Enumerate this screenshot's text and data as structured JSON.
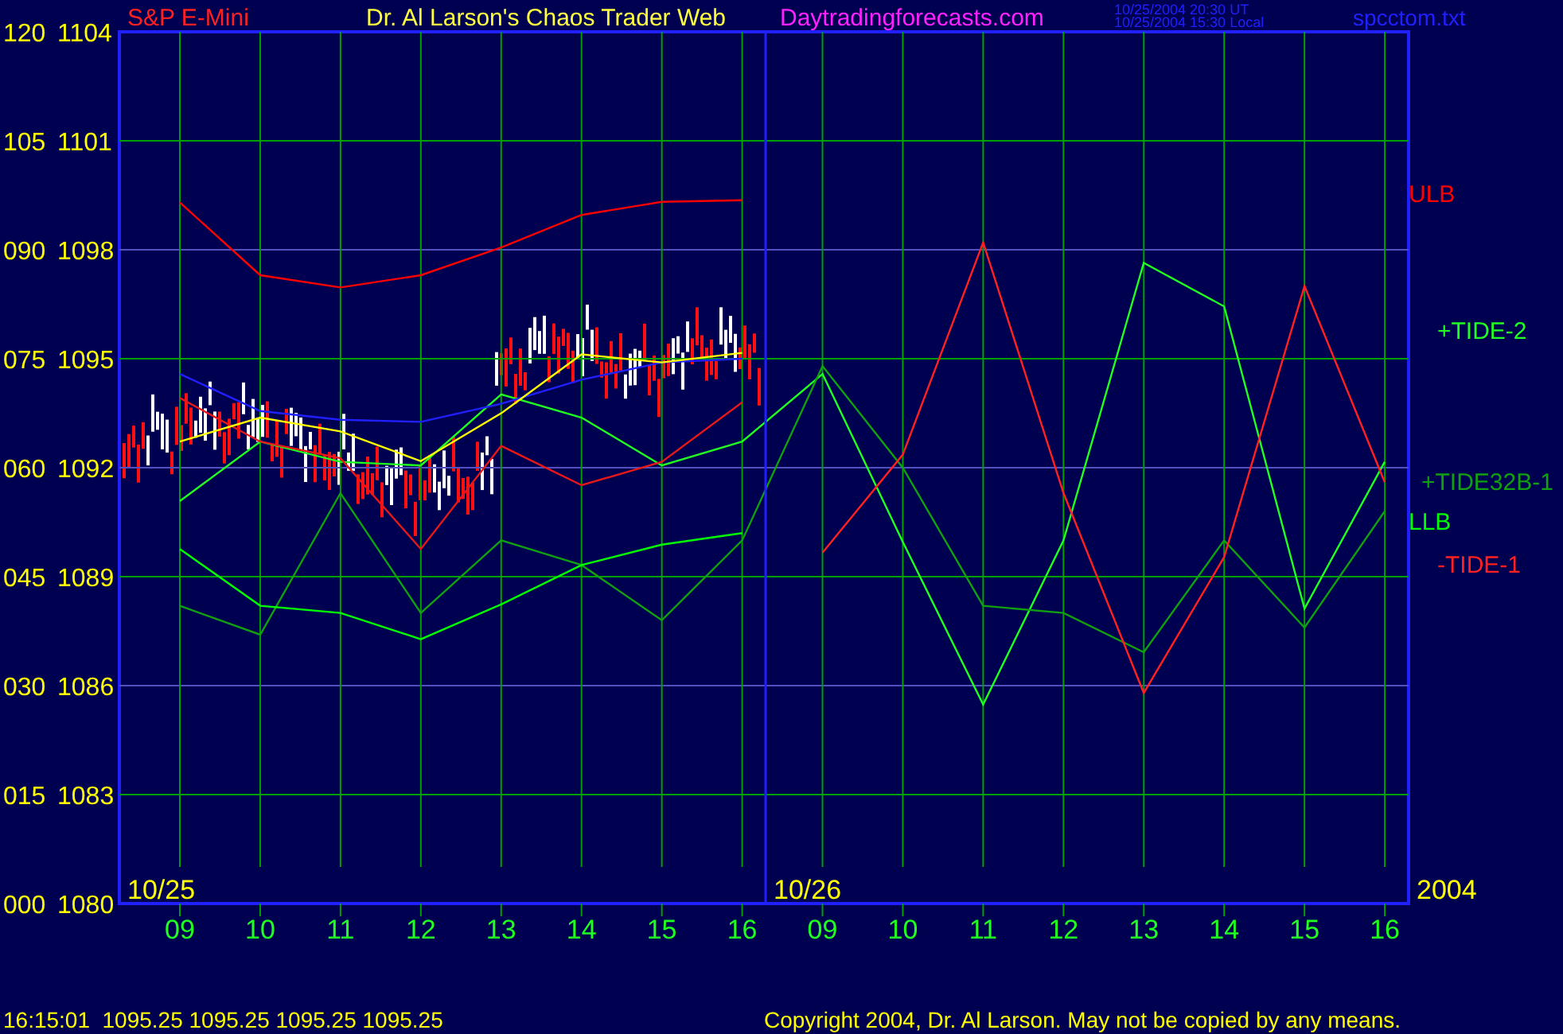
{
  "chart": {
    "instrument": "S&P E-Mini",
    "title": "Dr. Al Larson's Chaos Trader Web",
    "site": "Daytradingforecasts.com",
    "timestamps": [
      "10/25/2004 20:30 UT",
      "10/25/2004 15:30 Local"
    ],
    "file": "spcctom.txt",
    "price_labels": [
      "1104",
      "1101",
      "1098",
      "1095",
      "1092",
      "1089",
      "1086",
      "1083",
      "1080"
    ],
    "date_labels": [
      "10/25",
      "10/26",
      "2004"
    ],
    "chart_data": {
      "type": "line",
      "grid": true,
      "ylim": [
        0,
        120
      ],
      "categories": [
        "09",
        "10",
        "11",
        "12",
        "13",
        "14",
        "15",
        "16",
        "09",
        "10",
        "11",
        "12",
        "13",
        "14",
        "15",
        "16"
      ],
      "yticks": [
        {
          "value": 120,
          "label": "120"
        },
        {
          "value": 105,
          "label": "105"
        },
        {
          "value": 90,
          "label": "090"
        },
        {
          "value": 75,
          "label": "075"
        },
        {
          "value": 60,
          "label": "060"
        },
        {
          "value": 45,
          "label": "045"
        },
        {
          "value": 30,
          "label": "030"
        },
        {
          "value": 15,
          "label": "015"
        },
        {
          "value": 0,
          "label": "000"
        }
      ],
      "series": [
        {
          "name": "ULB",
          "color": "#ff0000",
          "values": [
            96.5,
            86.5,
            84.8,
            86.5,
            90.3,
            94.8,
            96.6,
            96.8,
            null,
            null,
            null,
            null,
            null,
            null,
            null,
            null
          ]
        },
        {
          "name": "+TIDE-2",
          "color": "#20ff20",
          "values": [
            55.4,
            63.6,
            60.8,
            60.3,
            70.1,
            66.9,
            60.3,
            63.6,
            72.9,
            49.8,
            27.4,
            50,
            88.2,
            82.2,
            40.6,
            60.8
          ]
        },
        {
          "name": "+TIDE32B-1",
          "color": "#10a010",
          "values": [
            41,
            37,
            56.5,
            40,
            50,
            46.6,
            39,
            50,
            74,
            60,
            41,
            40,
            34.6,
            50,
            38,
            54
          ]
        },
        {
          "name": "LLB",
          "color": "#00ff00",
          "values": [
            48.8,
            41,
            40,
            36.4,
            41.2,
            46.6,
            49.4,
            51,
            null,
            null,
            null,
            null,
            null,
            null,
            null,
            null
          ]
        },
        {
          "name": "-TIDE-1",
          "color": "#ff2020",
          "values": [
            null,
            null,
            null,
            null,
            null,
            null,
            null,
            null,
            48.3,
            61.8,
            91,
            56.5,
            29,
            47.7,
            85,
            58
          ]
        },
        {
          "color": "#2020ff",
          "values": [
            72.9,
            67.8,
            66.6,
            66.3,
            68.8,
            72.1,
            74.5,
            75,
            null,
            null,
            null,
            null,
            null,
            null,
            null,
            null
          ]
        },
        {
          "color": "#e81818",
          "values": [
            69.6,
            63.6,
            61.3,
            48.8,
            63,
            57.6,
            60.8,
            69,
            null,
            null,
            null,
            null,
            null,
            null,
            null,
            null
          ]
        },
        {
          "color": "#ffff00",
          "values": [
            63.6,
            66.9,
            65,
            60.9,
            67.5,
            75.6,
            74.5,
            75.8,
            null,
            null,
            null,
            null,
            null,
            null,
            null,
            null
          ]
        }
      ]
    }
  },
  "status_bar": {
    "quote": "16:15:01  1095.25 1095.25 1095.25 1095.25",
    "copyright": "Copyright 2004, Dr. Al Larson. May not be copied by any means."
  }
}
